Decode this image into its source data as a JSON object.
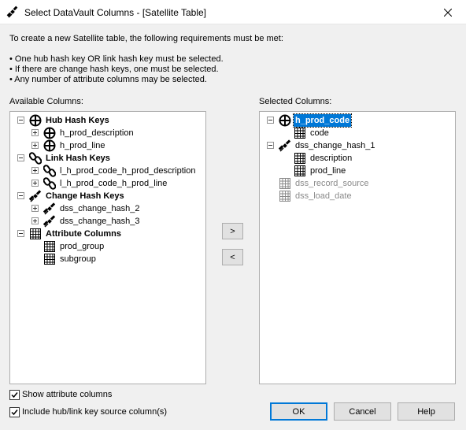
{
  "window": {
    "title": "Select DataVault Columns - [Satellite Table]"
  },
  "intro": "To create a new Satellite table, the following requirements must be met:",
  "requirements": [
    "• One hub hash key OR link hash key must be selected.",
    "• If there are change hash keys, one must be selected.",
    "• Any number of attribute columns may be selected."
  ],
  "available": {
    "label": "Available Columns:",
    "groups": {
      "hub": {
        "label": "Hub Hash Keys",
        "items": [
          "h_prod_description",
          "h_prod_line"
        ]
      },
      "link": {
        "label": "Link Hash Keys",
        "items": [
          "l_h_prod_code_h_prod_description",
          "l_h_prod_code_h_prod_line"
        ]
      },
      "change": {
        "label": "Change Hash Keys",
        "items": [
          "dss_change_hash_2",
          "dss_change_hash_3"
        ]
      },
      "attr": {
        "label": "Attribute Columns",
        "items": [
          "prod_group",
          "subgroup"
        ]
      }
    }
  },
  "selected": {
    "label": "Selected Columns:",
    "hub": {
      "label": "h_prod_code",
      "children": [
        "code"
      ]
    },
    "change": {
      "label": "dss_change_hash_1",
      "children": [
        "description",
        "prod_line"
      ]
    },
    "extra": [
      "dss_record_source",
      "dss_load_date"
    ]
  },
  "buttons": {
    "add": ">",
    "remove": "<",
    "ok": "OK",
    "cancel": "Cancel",
    "help": "Help"
  },
  "options": {
    "show_attr": {
      "label": "Show attribute columns",
      "checked": true
    },
    "include_src": {
      "label": "Include hub/link key source column(s)",
      "checked": true
    }
  },
  "colors": {
    "selection": "#0078d7",
    "accent": "#0078d7",
    "disabled_text": "#8a8a8a"
  }
}
